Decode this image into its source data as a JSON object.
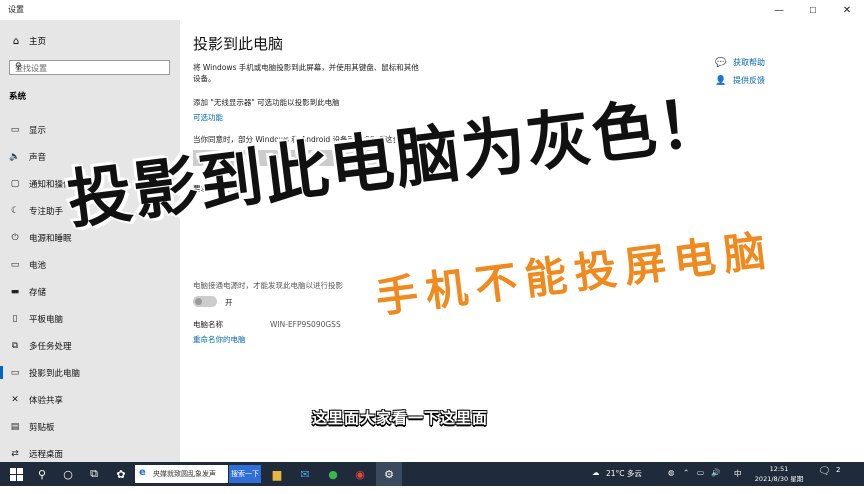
{
  "window": {
    "app_title": "设置",
    "controls": {
      "minimize": "—",
      "maximize": "☐",
      "close": "✕"
    }
  },
  "sidebar": {
    "home_label": "主页",
    "search_placeholder": "查找设置",
    "category": "系统",
    "items": [
      {
        "label": "显示",
        "icon": "display-icon",
        "glyph": "▭"
      },
      {
        "label": "声音",
        "icon": "speaker-icon",
        "glyph": "🔈"
      },
      {
        "label": "通知和操作",
        "icon": "notification-icon",
        "glyph": "▢"
      },
      {
        "label": "专注助手",
        "icon": "moon-icon",
        "glyph": "☾"
      },
      {
        "label": "电源和睡眠",
        "icon": "power-icon",
        "glyph": "⏻"
      },
      {
        "label": "电池",
        "icon": "battery-icon",
        "glyph": "▭"
      },
      {
        "label": "存储",
        "icon": "storage-icon",
        "glyph": "▬"
      },
      {
        "label": "平板电脑",
        "icon": "tablet-icon",
        "glyph": "▯"
      },
      {
        "label": "多任务处理",
        "icon": "multitask-icon",
        "glyph": "⧉"
      },
      {
        "label": "投影到此电脑",
        "icon": "project-icon",
        "glyph": "▭"
      },
      {
        "label": "体验共享",
        "icon": "share-icon",
        "glyph": "✕"
      },
      {
        "label": "剪贴板",
        "icon": "clipboard-icon",
        "glyph": "▤"
      },
      {
        "label": "远程桌面",
        "icon": "remote-icon",
        "glyph": "⇄"
      }
    ],
    "active_index": 9
  },
  "main": {
    "title": "投影到此电脑",
    "description_1": "将 Windows 手机或电脑投影到此屏幕，并使用其键盘、鼠标和其他",
    "description_2": "设备。",
    "add_display_text": "添加 \"无线显示器\" 可选功能以投影到此电脑",
    "optional_features_link": "可选功能",
    "agree_label": "当你同意时，部分 Windows 和 Android 设备可以投影到这台电脑",
    "agree_dropdown_value": "始终关闭(推荐)",
    "require_label": "要求投影到这台",
    "pin_text_partial": "电脑接通电源时，才能发现此电脑以进行投影",
    "toggle_state": "开",
    "pc_name_label": "电脑名称",
    "pc_name_value": "WIN-EFP9S090GSS",
    "rename_link": "重命名你的电脑",
    "help_link": "获取帮助",
    "feedback_link": "提供反馈"
  },
  "overlay": {
    "headline": "投影到此电脑为灰色！",
    "subheadline": "手机不能投屏电脑",
    "subtitle": "这里面大家看一下这里面",
    "headline_color": "#111111",
    "subheadline_color": "#f08a1e"
  },
  "taskbar": {
    "search_text": "央媒就致圆乱象发声",
    "search_button": "搜索一下",
    "weather": "21°C 多云",
    "lang": "中",
    "time": "12:51",
    "date": "2021/8/30 星期一",
    "notification_count": "2"
  },
  "colors": {
    "accent": "#0067b8",
    "sidebar_bg": "#e6e6e6",
    "taskbar_bg": "#1f2b3a"
  }
}
